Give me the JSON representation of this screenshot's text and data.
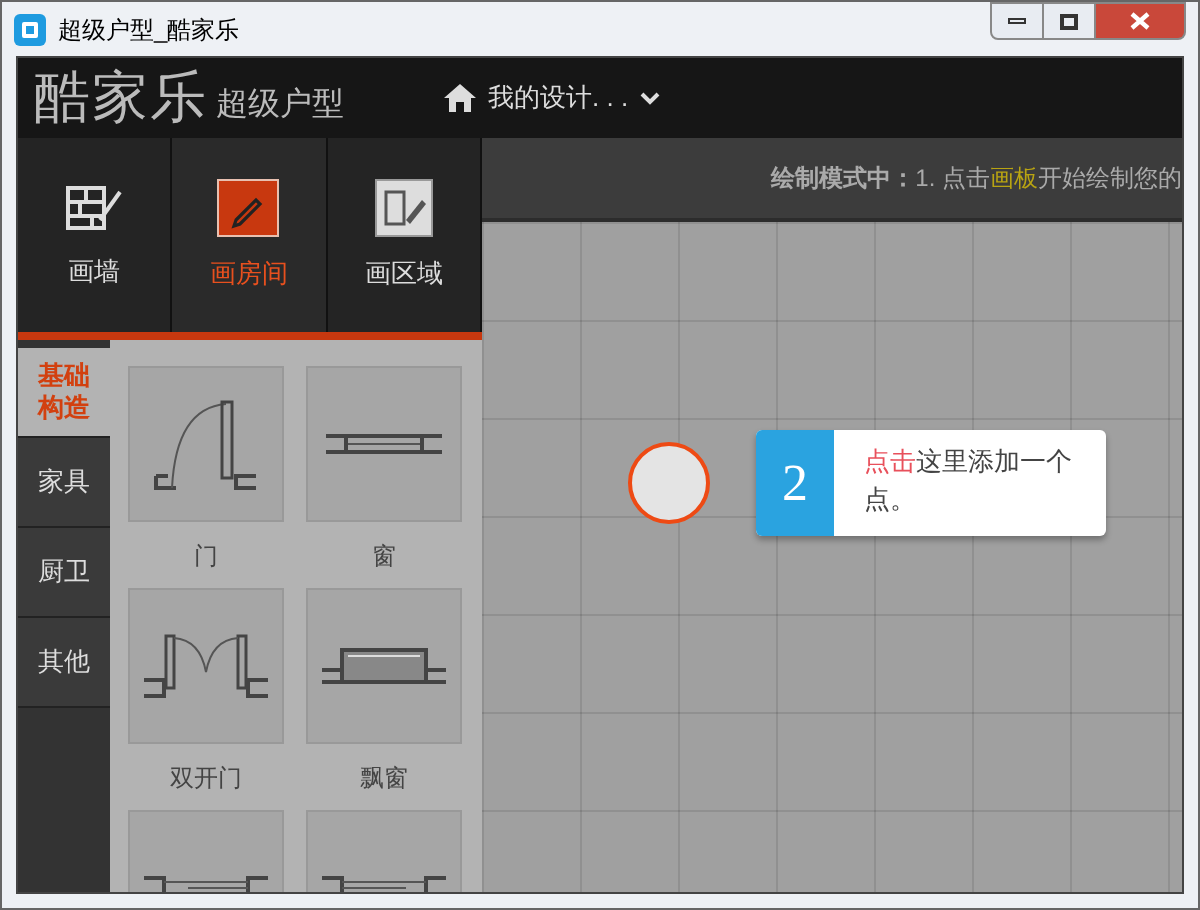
{
  "window": {
    "title": "超级户型_酷家乐"
  },
  "header": {
    "logo": "酷家乐",
    "product": "超级户型",
    "menu": "我的设计. . ."
  },
  "tools": [
    {
      "kind": "wall",
      "label": "画墙",
      "selected": false
    },
    {
      "kind": "room",
      "label": "画房间",
      "selected": true
    },
    {
      "kind": "area",
      "label": "画区域",
      "selected": false
    }
  ],
  "categories": [
    {
      "label": "基础构造",
      "selected": true
    },
    {
      "label": "家具",
      "selected": false
    },
    {
      "label": "厨卫",
      "selected": false
    },
    {
      "label": "其他",
      "selected": false
    }
  ],
  "components": [
    {
      "kind": "door",
      "label": "门"
    },
    {
      "kind": "window",
      "label": "窗"
    },
    {
      "kind": "double-door",
      "label": "双开门"
    },
    {
      "kind": "bay-window",
      "label": "飘窗"
    },
    {
      "kind": "sliding-door"
    },
    {
      "kind": "sliding-window"
    }
  ],
  "instruction": {
    "mode": "绘制模式中：",
    "segments": [
      {
        "text": "1. 点击",
        "highlight": false
      },
      {
        "text": "画板",
        "highlight": true
      },
      {
        "text": "开始绘制您的",
        "highlight": false
      }
    ]
  },
  "tip": {
    "step": "2",
    "segments": [
      {
        "text": "点击",
        "highlight": true
      },
      {
        "text": "这里添加一个点。",
        "highlight": false
      }
    ]
  }
}
